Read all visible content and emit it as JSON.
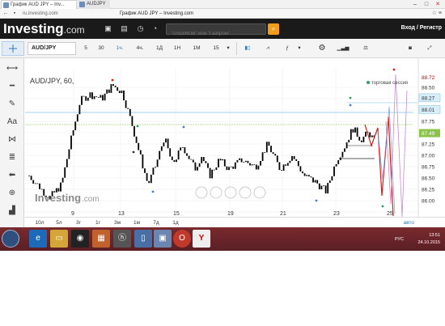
{
  "browser": {
    "tabs": [
      {
        "label": "График AUD JPY – Inv..."
      },
      {
        "label": "AUDJPY"
      }
    ],
    "url": "ru.investing.com",
    "page_title": "График AUD JPY – Investing.com"
  },
  "header": {
    "logo_main": "Investing",
    "logo_suffix": ".com",
    "search_placeholder": "\"USD/RUB\" или \"Газпром\"",
    "right_text": "Вход / Регистр"
  },
  "toolbar": {
    "symbol": "AUD/JPY",
    "intervals": [
      "5",
      "30",
      "1ч.",
      "4ч.",
      "1Д",
      "1Н",
      "1М"
    ],
    "active_interval": "1ч.",
    "bar_count": "15"
  },
  "chart": {
    "legend": "AUD/JPY, 60,",
    "session_label": "торговая сессия",
    "watermark_main": "Investing",
    "watermark_suffix": ".com",
    "price_labels": [
      "88.72",
      "88.50",
      "88.27",
      "88.01",
      "87.75",
      "87.49",
      "87.25",
      "87.00",
      "86.75",
      "86.50",
      "86.25",
      "86.00"
    ],
    "x_labels": [
      "9",
      "13",
      "15",
      "19",
      "21",
      "23",
      "25"
    ]
  },
  "chart_data": {
    "type": "candlestick",
    "instrument": "AUD/JPY",
    "interval": "60",
    "ylim": [
      85.75,
      88.75
    ],
    "current_price": 87.49,
    "reference_levels": [
      88.27,
      88.01
    ]
  },
  "periods": {
    "items": [
      "10л",
      "5л",
      "3г",
      "1г",
      "3м",
      "1м",
      "7д",
      "1д"
    ],
    "auto": "авто"
  },
  "taskbar": {
    "lang": "РУС",
    "time": "13:51",
    "date": "24.10.2015"
  },
  "colors": {
    "up": "#2e7d32",
    "down": "#8b1c1c",
    "accent": "#f29d1b",
    "active_blue": "#2a7ac7",
    "taskbar": "#6a242b"
  }
}
